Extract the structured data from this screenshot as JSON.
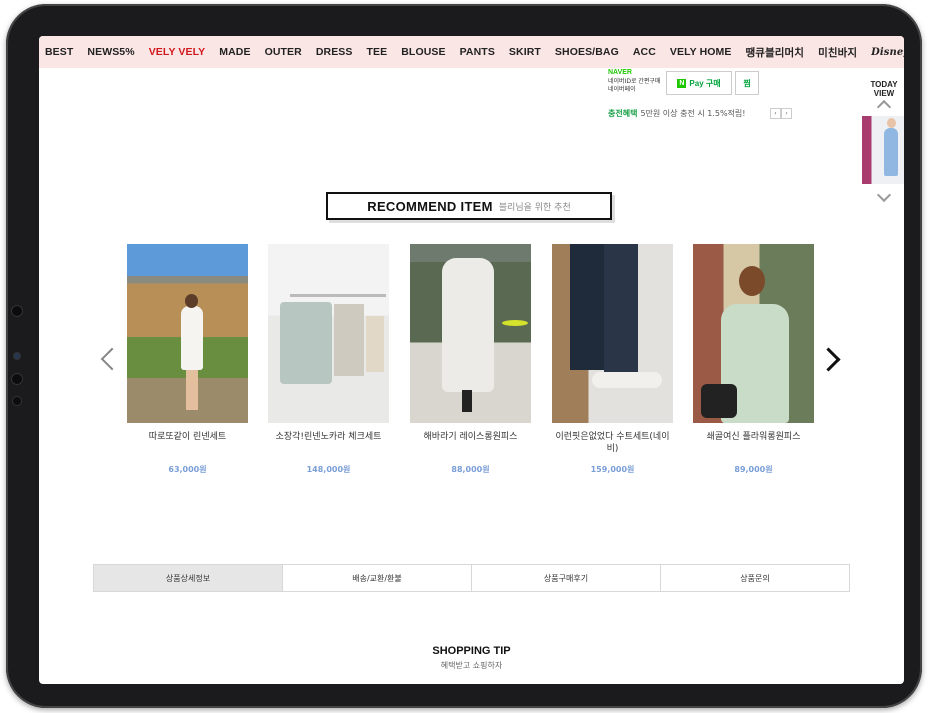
{
  "nav": {
    "items": [
      "BEST",
      "NEWS5%",
      "VELY VELY",
      "MADE",
      "OUTER",
      "DRESS",
      "TEE",
      "BLOUSE",
      "PANTS",
      "SKIRT",
      "SHOES/BAG",
      "ACC",
      "VELY HOME",
      "땡큐블리머치",
      "미친바지"
    ],
    "active_color": "#d0181d",
    "brand_logo": "Disney"
  },
  "naver": {
    "brand": "NAVER",
    "desc": "네이버ID로 간편구매 네이버페이",
    "pay_label": "Pay 구매",
    "zzim_label": "찜",
    "benefit_label": "충전혜택",
    "benefit_text": "5만원 이상 충전 시 1.5%적립!"
  },
  "today_view": {
    "line1": "TODAY",
    "line2": "VIEW"
  },
  "recommend": {
    "title": "RECOMMEND ITEM",
    "subtitle": "블리님을 위한 추천"
  },
  "products": [
    {
      "name": "따로또같이 린넨세트",
      "price": "63,000원"
    },
    {
      "name": "소장각!린넨노카라 체크세트",
      "price": "148,000원"
    },
    {
      "name": "해바라기 레이스롱원피스",
      "price": "88,000원"
    },
    {
      "name": "이런핏은없었다 수트세트(네이비)",
      "price": "159,000원"
    },
    {
      "name": "쇄골여신 플라워롱원피스",
      "price": "89,000원"
    }
  ],
  "tabs": [
    "상품상세정보",
    "배송/교환/환불",
    "상품구매후기",
    "상품문의"
  ],
  "shopping_tip": {
    "title": "SHOPPING TIP",
    "subtitle": "혜택받고 쇼핑하자"
  }
}
